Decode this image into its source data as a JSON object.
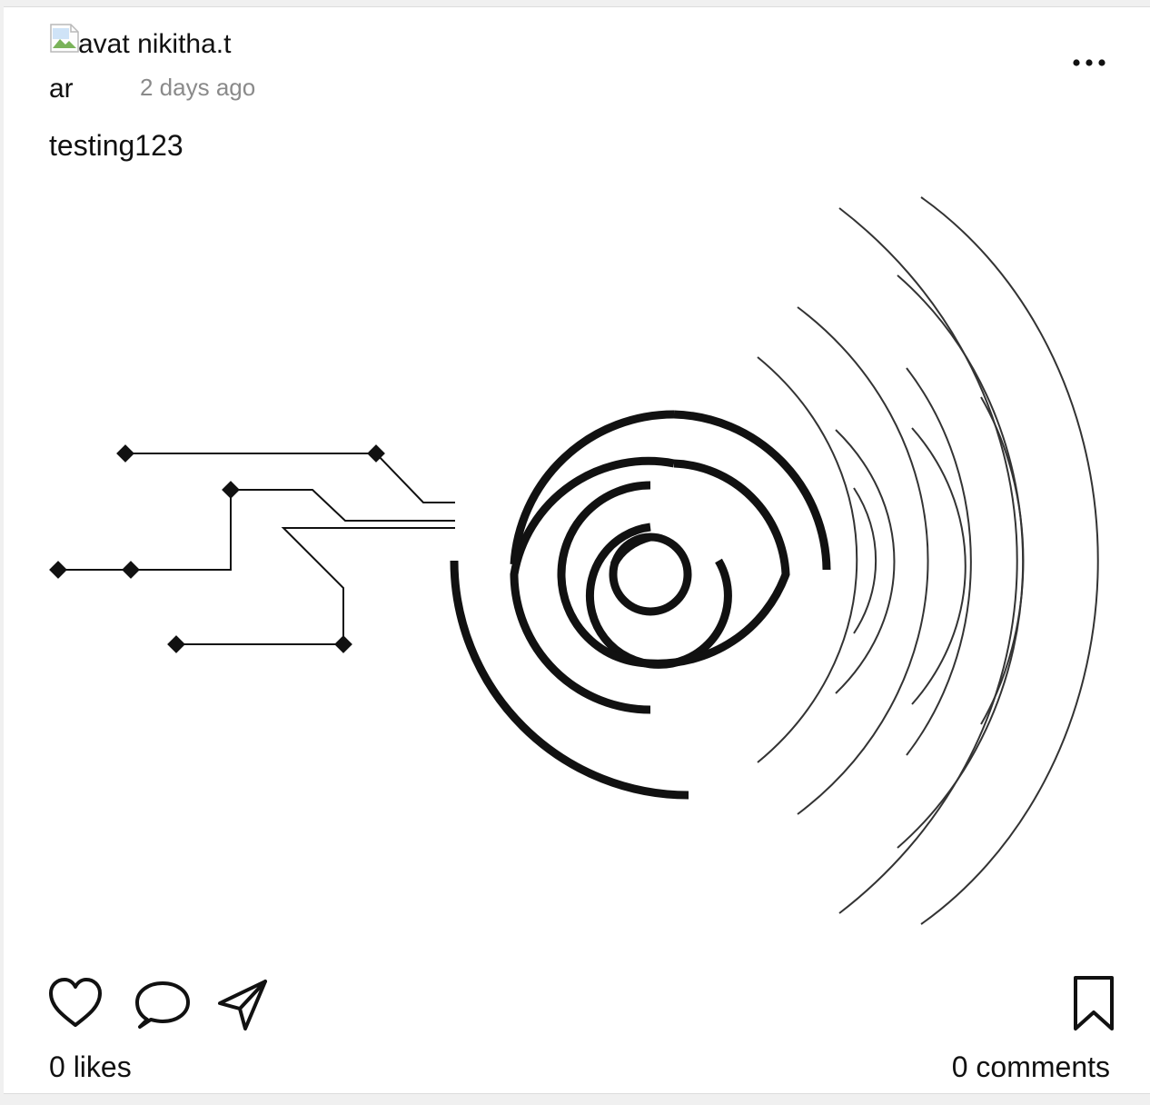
{
  "post": {
    "avatar_alt_start": "avat",
    "avatar_alt_end": "ar",
    "username": "nikitha.t",
    "timestamp": "2 days ago",
    "caption": "testing123",
    "likes_label": "0 likes",
    "comments_label": "0 comments"
  },
  "icons": {
    "avatar": "broken-image-icon",
    "more": "more-horizontal-icon",
    "like": "heart-outline-icon",
    "comment": "speech-bubble-icon",
    "share": "paper-plane-icon",
    "save": "bookmark-outline-icon"
  },
  "colors": {
    "text": "#111111",
    "muted": "#8a8a8a",
    "background": "#ffffff"
  }
}
